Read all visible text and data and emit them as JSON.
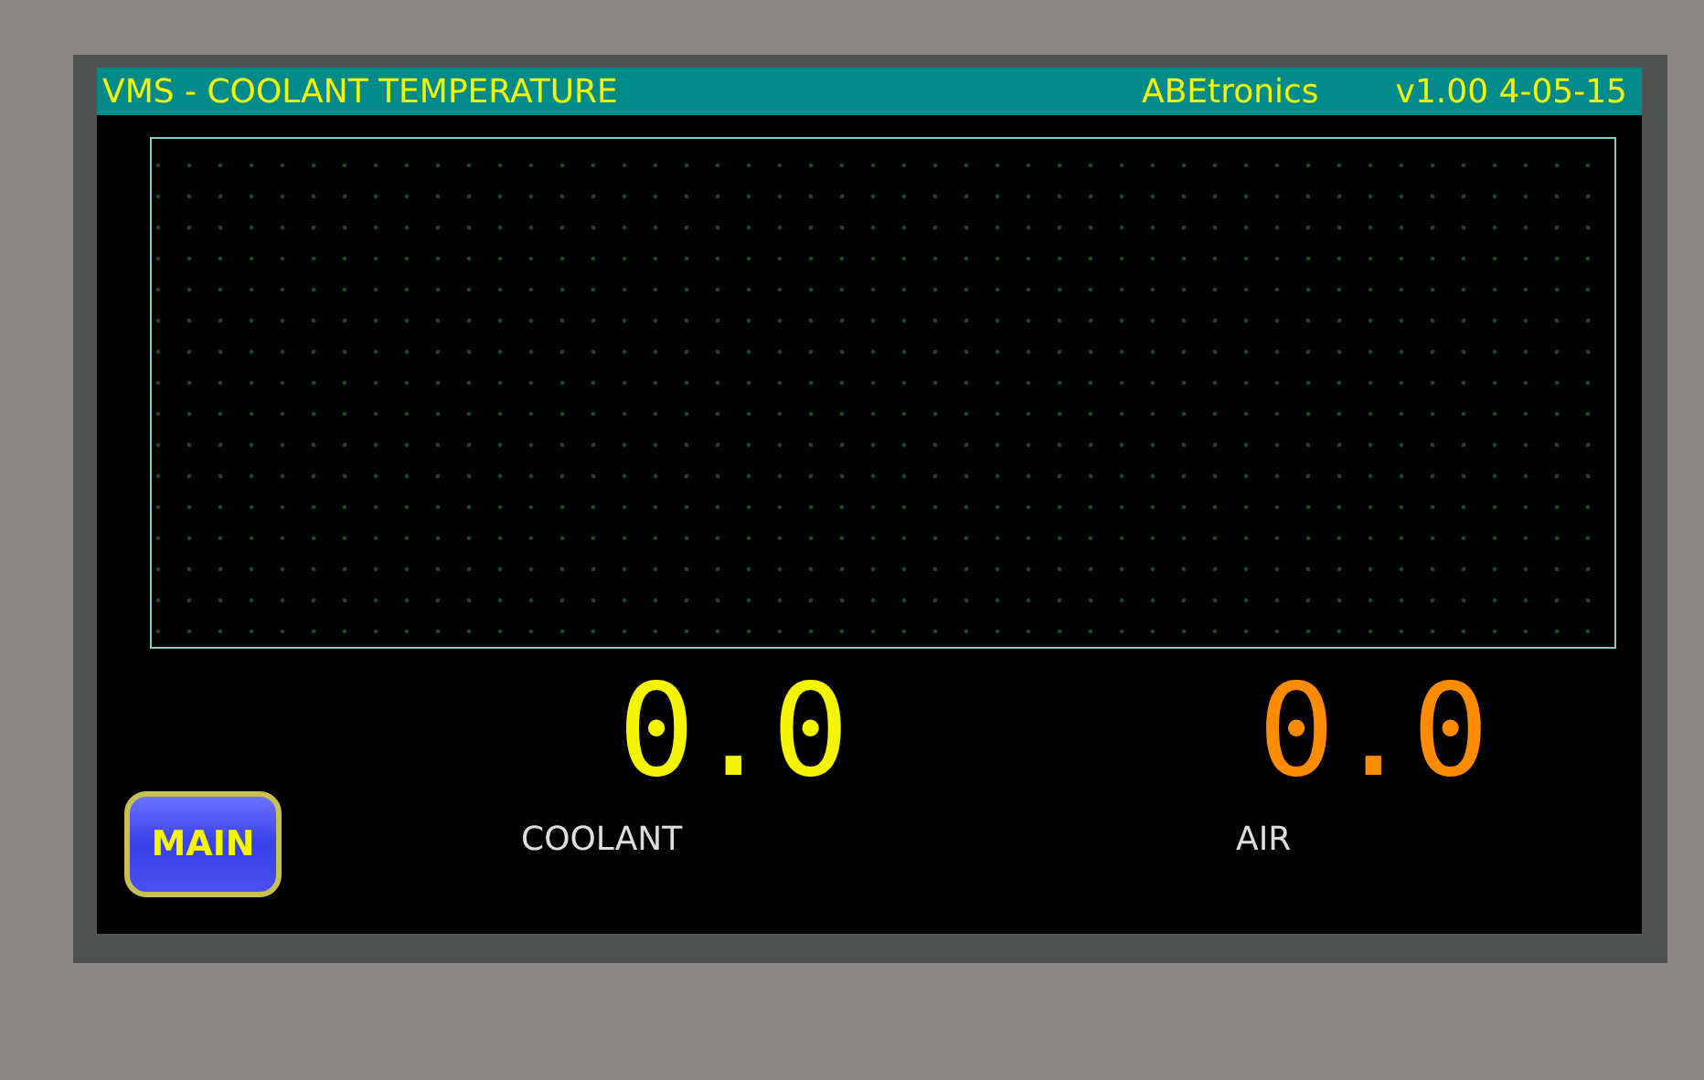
{
  "header": {
    "title": "VMS - COOLANT TEMPERATURE",
    "brand": "ABEtronics",
    "version": "v1.00 4-05-15"
  },
  "readouts": [
    {
      "value": "0.0",
      "label": "COOLANT",
      "color": "#f5f500"
    },
    {
      "value": "0.0",
      "label": "AIR",
      "color": "#ff8c00"
    }
  ],
  "main_button": {
    "label": "MAIN"
  }
}
